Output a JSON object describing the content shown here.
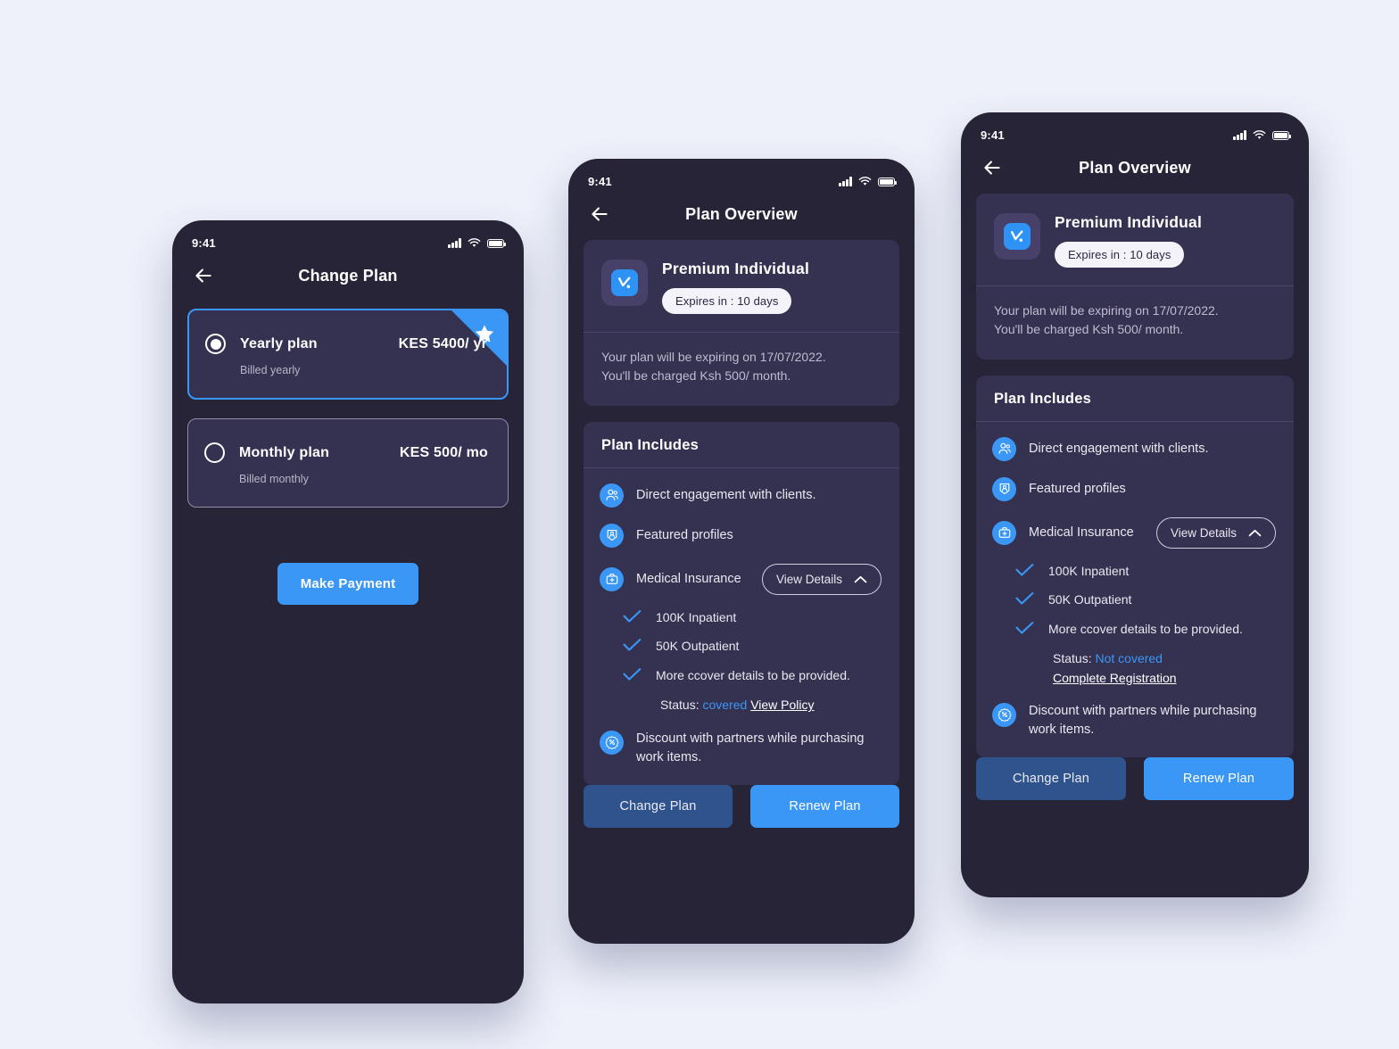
{
  "colors": {
    "page_bg": "#eef1fa",
    "phone_bg": "#272438",
    "card_bg": "#353151",
    "accent_blue": "#3b97f5",
    "muted_blue_btn": "#2f538c",
    "chip_bg": "#f5f3fa",
    "muted_text": "#bfbccf"
  },
  "status_bar": {
    "time": "9:41",
    "signal_icon": "signal-bars-icon",
    "wifi_icon": "wifi-icon",
    "battery_icon": "battery-icon"
  },
  "change_plan_screen": {
    "title": "Change Plan",
    "back_icon": "back-arrow-icon",
    "star_badge_icon": "star-icon",
    "plans": [
      {
        "name": "Yearly plan",
        "price": "KES 5400/ yr",
        "billing": "Billed yearly",
        "selected": true,
        "featured": true
      },
      {
        "name": "Monthly plan",
        "price": "KES 500/ mo",
        "billing": "Billed monthly",
        "selected": false,
        "featured": false
      }
    ],
    "cta": "Make Payment"
  },
  "plan_overview": {
    "title": "Plan Overview",
    "back_icon": "back-arrow-icon",
    "app_icon": "app-logo-icon",
    "plan_name": "Premium Individual",
    "expiry_chip": "Expires in : 10 days",
    "note_line1": "Your plan will be expiring on 17/07/2022.",
    "note_line2": "You'll be charged Ksh 500/ month.",
    "includes_title": "Plan Includes",
    "features": [
      {
        "icon": "users-group-icon",
        "label": "Direct engagement with clients."
      },
      {
        "icon": "featured-profile-icon",
        "label": "Featured profiles"
      },
      {
        "icon": "medical-bag-icon",
        "label": "Medical Insurance",
        "action": "View Details",
        "action_icon": "chevron-up-icon"
      },
      {
        "icon": "discount-percent-icon",
        "label": "Discount with partners while purchasing work items."
      }
    ],
    "insurance_details": [
      {
        "check_icon": "check-icon",
        "text": "100K Inpatient"
      },
      {
        "check_icon": "check-icon",
        "text": "50K Outpatient"
      },
      {
        "check_icon": "check-icon",
        "text": "More ccover details to be provided."
      }
    ],
    "variant_covered": {
      "status_label": "Status:",
      "status_value": "covered",
      "status_link": "View Policy"
    },
    "variant_not_covered": {
      "status_label": "Status:",
      "status_value": "Not covered",
      "status_link": "Complete Registration"
    },
    "footer": {
      "secondary": "Change Plan",
      "primary": "Renew Plan"
    }
  }
}
